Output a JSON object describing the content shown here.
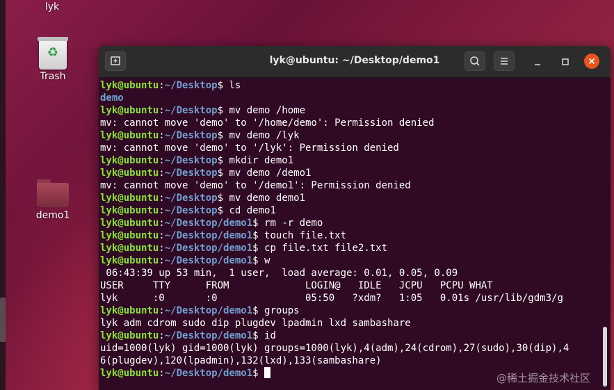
{
  "desktop": {
    "top_label": "lyk",
    "trash_label": "Trash",
    "folder_label": "demo1"
  },
  "window": {
    "title": "lyk@ubuntu: ~/Desktop/demo1"
  },
  "terminal": {
    "lines": [
      {
        "u": "lyk@ubuntu",
        "s": ":",
        "p": "~/Desktop",
        "d": "$ ",
        "c": "ls"
      },
      {
        "dir": "demo"
      },
      {
        "u": "lyk@ubuntu",
        "s": ":",
        "p": "~/Desktop",
        "d": "$ ",
        "c": "mv demo /home"
      },
      {
        "t": "mv: cannot move 'demo' to '/home/demo': Permission denied"
      },
      {
        "u": "lyk@ubuntu",
        "s": ":",
        "p": "~/Desktop",
        "d": "$ ",
        "c": "mv demo /lyk"
      },
      {
        "t": "mv: cannot move 'demo' to '/lyk': Permission denied"
      },
      {
        "u": "lyk@ubuntu",
        "s": ":",
        "p": "~/Desktop",
        "d": "$ ",
        "c": "mkdir demo1"
      },
      {
        "u": "lyk@ubuntu",
        "s": ":",
        "p": "~/Desktop",
        "d": "$ ",
        "c": "mv demo /demo1"
      },
      {
        "t": "mv: cannot move 'demo' to '/demo1': Permission denied"
      },
      {
        "u": "lyk@ubuntu",
        "s": ":",
        "p": "~/Desktop",
        "d": "$ ",
        "c": "mv demo demo1"
      },
      {
        "u": "lyk@ubuntu",
        "s": ":",
        "p": "~/Desktop",
        "d": "$ ",
        "c": "cd demo1"
      },
      {
        "u": "lyk@ubuntu",
        "s": ":",
        "p": "~/Desktop/demo1",
        "d": "$ ",
        "c": "rm -r demo"
      },
      {
        "u": "lyk@ubuntu",
        "s": ":",
        "p": "~/Desktop/demo1",
        "d": "$ ",
        "c": "touch file.txt"
      },
      {
        "u": "lyk@ubuntu",
        "s": ":",
        "p": "~/Desktop/demo1",
        "d": "$ ",
        "c": "cp file.txt file2.txt"
      },
      {
        "u": "lyk@ubuntu",
        "s": ":",
        "p": "~/Desktop/demo1",
        "d": "$ ",
        "c": "w"
      },
      {
        "t": " 06:43:39 up 53 min,  1 user,  load average: 0.01, 0.05, 0.09"
      },
      {
        "t": "USER     TTY      FROM             LOGIN@   IDLE   JCPU   PCPU WHAT"
      },
      {
        "t": "lyk      :0       :0               05:50   ?xdm?   1:05   0.01s /usr/lib/gdm3/g"
      },
      {
        "u": "lyk@ubuntu",
        "s": ":",
        "p": "~/Desktop/demo1",
        "d": "$ ",
        "c": "groups"
      },
      {
        "t": "lyk adm cdrom sudo dip plugdev lpadmin lxd sambashare"
      },
      {
        "u": "lyk@ubuntu",
        "s": ":",
        "p": "~/Desktop/demo1",
        "d": "$ ",
        "c": "id"
      },
      {
        "t": "uid=1000(lyk) gid=1000(lyk) groups=1000(lyk),4(adm),24(cdrom),27(sudo),30(dip),4"
      },
      {
        "t": "6(plugdev),120(lpadmin),132(lxd),133(sambashare)"
      },
      {
        "u": "lyk@ubuntu",
        "s": ":",
        "p": "~/Desktop/demo1",
        "d": "$ ",
        "c": "",
        "cursor": true
      }
    ]
  },
  "watermark": "@稀土掘金技术社区",
  "icons": {
    "new_tab": "new-tab-icon",
    "search": "search-icon",
    "menu": "hamburger-menu-icon",
    "minimize": "minimize-icon",
    "maximize": "maximize-icon",
    "close": "close-icon"
  },
  "colors": {
    "terminal_bg": "#300a24",
    "prompt_user": "#8ae234",
    "prompt_path": "#729fcf",
    "close_button": "#e95420"
  }
}
